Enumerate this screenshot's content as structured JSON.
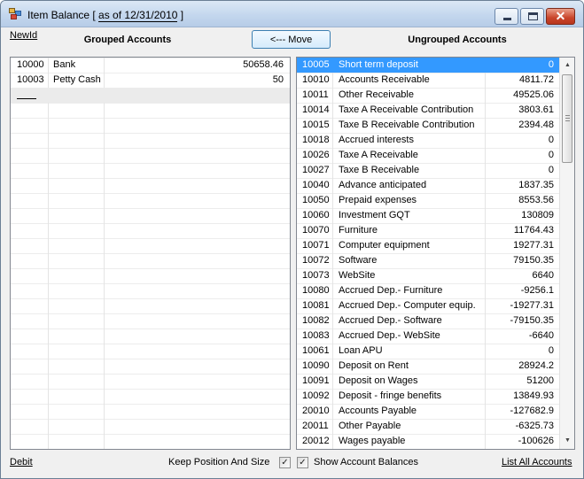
{
  "window": {
    "title_prefix": "Item Balance [ ",
    "title_date": "as of 12/31/2010",
    "title_suffix": " ]",
    "close_glyph": "✕"
  },
  "toolbar": {
    "newid_link": "NewId",
    "grouped_header": "Grouped Accounts",
    "move_button": "<--- Move",
    "ungrouped_header": "Ungrouped Accounts"
  },
  "grouped": [
    {
      "id": "10000",
      "name": "Bank",
      "value": "50658.46"
    },
    {
      "id": "10003",
      "name": "Petty Cash",
      "value": "50"
    }
  ],
  "ungrouped": [
    {
      "id": "10005",
      "name": "Short term deposit",
      "value": "0"
    },
    {
      "id": "10010",
      "name": "Accounts Receivable",
      "value": "4811.72"
    },
    {
      "id": "10011",
      "name": "Other Receivable",
      "value": "49525.06"
    },
    {
      "id": "10014",
      "name": "Taxe A Receivable Contribution",
      "value": "3803.61"
    },
    {
      "id": "10015",
      "name": "Taxe B Receivable Contribution",
      "value": "2394.48"
    },
    {
      "id": "10018",
      "name": "Accrued interests",
      "value": "0"
    },
    {
      "id": "10026",
      "name": "Taxe A Receivable",
      "value": "0"
    },
    {
      "id": "10027",
      "name": "Taxe B Receivable",
      "value": "0"
    },
    {
      "id": "10040",
      "name": "Advance anticipated",
      "value": "1837.35"
    },
    {
      "id": "10050",
      "name": "Prepaid expenses",
      "value": "8553.56"
    },
    {
      "id": "10060",
      "name": "Investment GQT",
      "value": "130809"
    },
    {
      "id": "10070",
      "name": "Furniture",
      "value": "11764.43"
    },
    {
      "id": "10071",
      "name": "Computer equipment",
      "value": "19277.31"
    },
    {
      "id": "10072",
      "name": "Software",
      "value": "79150.35"
    },
    {
      "id": "10073",
      "name": "WebSite",
      "value": "6640"
    },
    {
      "id": "10080",
      "name": "Accrued Dep.- Furniture",
      "value": "-9256.1"
    },
    {
      "id": "10081",
      "name": "Accrued Dep.- Computer equip.",
      "value": "-19277.31"
    },
    {
      "id": "10082",
      "name": "Accrued Dep.- Software",
      "value": "-79150.35"
    },
    {
      "id": "10083",
      "name": "Accrued Dep.- WebSite",
      "value": "-6640"
    },
    {
      "id": "10061",
      "name": "Loan APU",
      "value": "0"
    },
    {
      "id": "10090",
      "name": "Deposit on Rent",
      "value": "28924.2"
    },
    {
      "id": "10091",
      "name": "Deposit on Wages",
      "value": "51200"
    },
    {
      "id": "10092",
      "name": "Deposit - fringe benefits",
      "value": "13849.93"
    },
    {
      "id": "20010",
      "name": "Accounts Payable",
      "value": "-127682.9"
    },
    {
      "id": "20011",
      "name": "Other Payable",
      "value": "-6325.73"
    },
    {
      "id": "20012",
      "name": "Wages payable",
      "value": "-100626"
    }
  ],
  "footer": {
    "debit_link": "Debit",
    "keep_position_label": "Keep Position And Size",
    "keep_position_checked": true,
    "show_balances_label": "Show Account Balances",
    "show_balances_checked": true,
    "list_all_link": "List All Accounts",
    "check_glyph": "✓"
  },
  "scrollbar": {
    "up_glyph": "▲",
    "down_glyph": "▼"
  },
  "colors": {
    "selection": "#3399ff",
    "window_bg": "#f0f0f0",
    "grid_border": "#828790"
  }
}
